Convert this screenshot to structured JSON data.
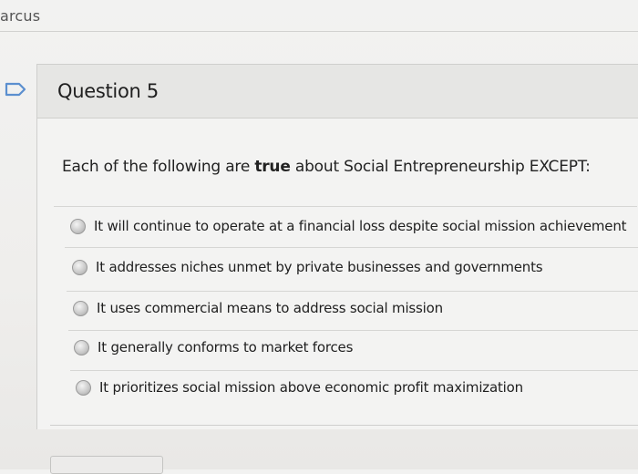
{
  "header": {
    "user_name": "arcus"
  },
  "question": {
    "title": "Question 5",
    "prompt_before": "Each of the following are ",
    "prompt_bold": "true",
    "prompt_after": " about Social Entrepreneurship EXCEPT:"
  },
  "options": [
    {
      "label": "It will continue to operate at a financial loss despite social mission achievement"
    },
    {
      "label": "It addresses niches unmet by private businesses and governments"
    },
    {
      "label": "It uses commercial means to address social mission"
    },
    {
      "label": "It generally conforms to market forces"
    },
    {
      "label": "It prioritizes social mission above economic profit maximization"
    }
  ],
  "colors": {
    "flag_stroke": "#5b8fcf",
    "background": "#f2f2f1"
  }
}
